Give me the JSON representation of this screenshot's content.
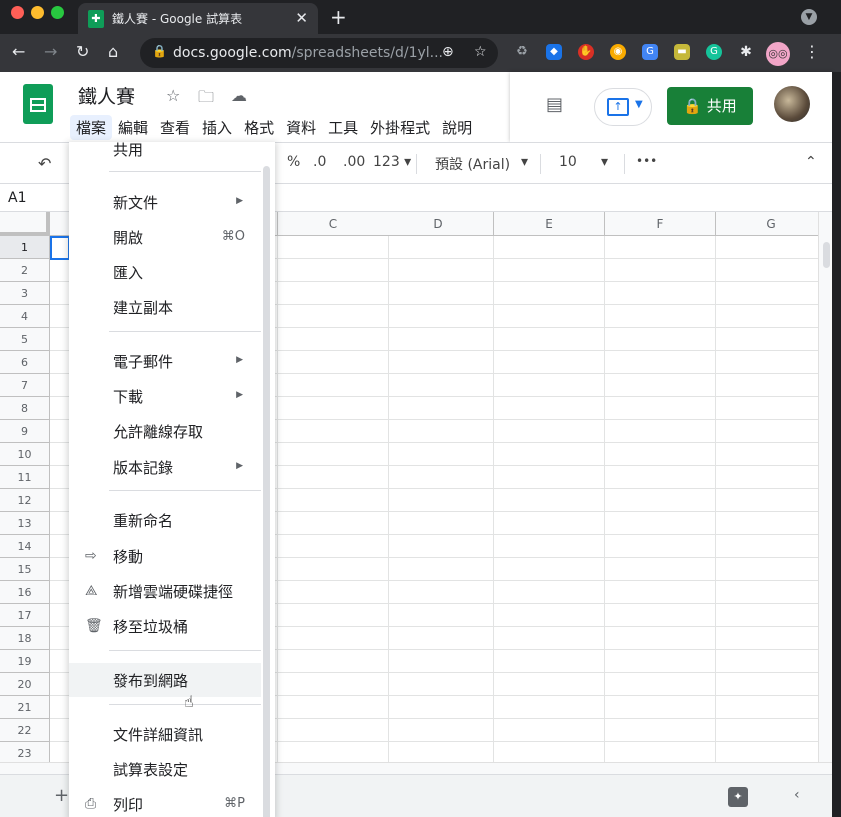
{
  "browser": {
    "tab_title": "鐵人賽 - Google 試算表",
    "url_host": "docs.google.com",
    "url_path": "/spreadsheets/d/1yl..."
  },
  "header": {
    "doc_title": "鐵人賽",
    "menus": [
      "檔案",
      "編輯",
      "查看",
      "插入",
      "格式",
      "資料",
      "工具",
      "外掛程式",
      "說明"
    ],
    "share_label": "共用"
  },
  "toolbar": {
    "percent": "%",
    "dec_less": ".0",
    "dec_more": ".00",
    "num_format": "123",
    "font": "預設 (Arial)",
    "size": "10",
    "more": "•••"
  },
  "formula": {
    "cell_ref": "A1"
  },
  "grid": {
    "columns": [
      "C",
      "D",
      "E",
      "F",
      "G"
    ],
    "rows": [
      "1",
      "2",
      "3",
      "4",
      "5",
      "6",
      "7",
      "8",
      "9",
      "10",
      "11",
      "12",
      "13",
      "14",
      "15",
      "16",
      "17",
      "18",
      "19",
      "20",
      "21",
      "22",
      "23"
    ]
  },
  "file_menu": {
    "partial_top": "共用",
    "items": [
      {
        "label": "新文件",
        "arrow": true
      },
      {
        "label": "開啟",
        "shortcut": "⌘O"
      },
      {
        "label": "匯入"
      },
      {
        "label": "建立副本"
      },
      {
        "label": "電子郵件",
        "arrow": true
      },
      {
        "label": "下載",
        "arrow": true
      },
      {
        "label": "允許離線存取"
      },
      {
        "label": "版本記錄",
        "arrow": true
      },
      {
        "label": "重新命名"
      },
      {
        "label": "移動",
        "icon": "folder-move-icon"
      },
      {
        "label": "新增雲端硬碟捷徑",
        "icon": "drive-shortcut-icon"
      },
      {
        "label": "移至垃圾桶",
        "icon": "trash-icon"
      },
      {
        "label": "發布到網路",
        "hover": true
      },
      {
        "label": "文件詳細資訊"
      },
      {
        "label": "試算表設定"
      },
      {
        "label": "列印",
        "icon": "print-icon",
        "shortcut": "⌘P"
      }
    ]
  }
}
